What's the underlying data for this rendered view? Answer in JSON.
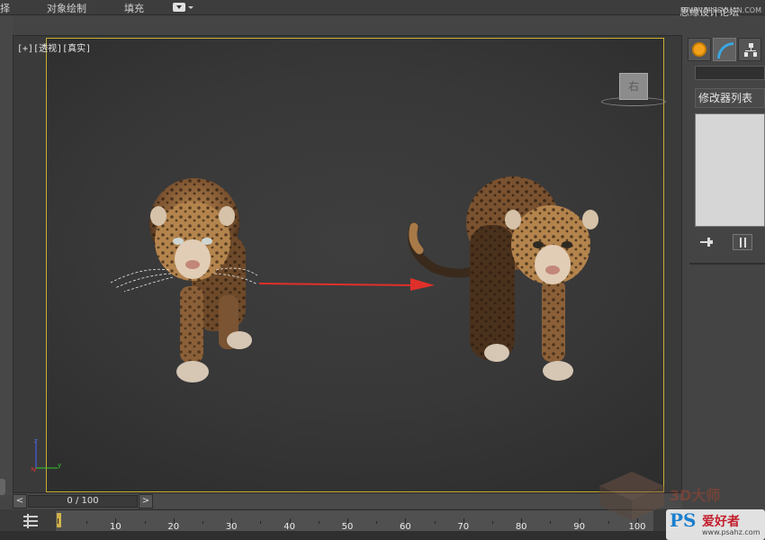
{
  "menu": {
    "item_0": "择",
    "item_1": "对象绘制",
    "item_2": "填充"
  },
  "watermark_top": {
    "site": "思缘设计论坛",
    "url": "WWW.MISSVUAN.COM"
  },
  "viewport": {
    "label": "[+][透视][真实]",
    "viewcube_face": "右"
  },
  "command_panel": {
    "modifier_list_label": "修改器列表",
    "name_value": ""
  },
  "time_slider": {
    "prev_label": "<",
    "next_label": ">",
    "frame_display": "0 / 100"
  },
  "track_bar": {
    "ticks": [
      "0",
      "10",
      "20",
      "30",
      "40",
      "50",
      "60",
      "70",
      "80",
      "90",
      "100"
    ]
  },
  "watermark_bottom": {
    "logo": "PS",
    "text": "爱好者",
    "url": "www.psahz.com",
    "faint": "3D大师"
  },
  "colors": {
    "viewport_border": "#c8b032",
    "arrow": "#e0302a",
    "accent_blue": "#39a6e0",
    "accent_orange": "#f2a21a"
  },
  "icons": {
    "create_tab": "sun-icon",
    "modify_tab": "arc-icon",
    "hierarchy_tab": "hierarchy-icon"
  }
}
